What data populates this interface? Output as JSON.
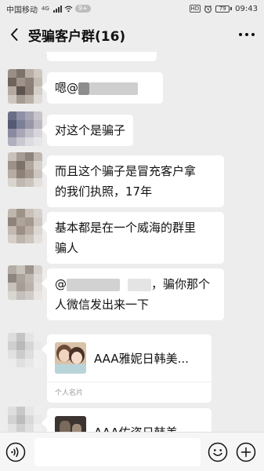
{
  "status_bar": {
    "carrier": "中国移动",
    "network": "4G",
    "badge": "9+",
    "hd": "HD",
    "battery": "79",
    "time": "09:43"
  },
  "header": {
    "title": "受骗客户群(16)"
  },
  "messages": [
    {
      "type": "text",
      "prefix": "嗯@",
      "redacted": true
    },
    {
      "type": "text",
      "text": "对这个是骗子"
    },
    {
      "type": "text",
      "line1": "而且这个骗子是冒充客户拿",
      "line2": "的我们执照，17年"
    },
    {
      "type": "text",
      "line1": "基本都是在一个威海的群里",
      "line2": "骗人"
    },
    {
      "type": "text",
      "mention": "@",
      "line1_tail": "，骗你那个",
      "line2": "人微信发出来一下",
      "redacted": true
    },
    {
      "type": "card",
      "name": "AAA雅妮日韩美...",
      "footer": "个人名片"
    },
    {
      "type": "card",
      "name": "AAA佑姿日韩美..."
    }
  ],
  "input_bar": {
    "value": ""
  },
  "colors": {
    "background": "#ededed",
    "bubble": "#ffffff",
    "input_bar": "#f6f6f6"
  },
  "icons": [
    "back-arrow-icon",
    "more-dots-icon",
    "voice-icon",
    "emoji-icon",
    "plus-icon",
    "alarm-icon",
    "wifi-icon",
    "signal-icon"
  ]
}
